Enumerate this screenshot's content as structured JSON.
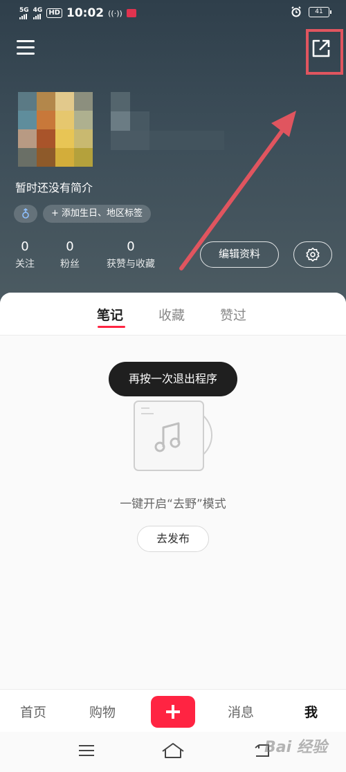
{
  "status_bar": {
    "network_1": "5G",
    "network_2": "4G",
    "hd_badge": "HD",
    "time": "10:02",
    "battery_level": "41"
  },
  "profile": {
    "bio": "暂时还没有简介",
    "gender_icon": "male-symbol",
    "add_tags_label": "+ 添加生日、地区标签",
    "stats": [
      {
        "value": "0",
        "label": "关注"
      },
      {
        "value": "0",
        "label": "粉丝"
      },
      {
        "value": "0",
        "label": "获赞与收藏"
      }
    ],
    "edit_label": "编辑资料"
  },
  "tabs": [
    {
      "label": "笔记",
      "active": true
    },
    {
      "label": "收藏",
      "active": false
    },
    {
      "label": "赞过",
      "active": false
    }
  ],
  "toast": "再按一次退出程序",
  "empty_state": {
    "icon": "music-note-record-icon",
    "text": "一键开启“去野”模式",
    "button_label": "去发布"
  },
  "bottom_nav": {
    "items": [
      {
        "label": "首页",
        "active": false
      },
      {
        "label": "购物",
        "active": false
      },
      {
        "label": "消息",
        "active": false
      },
      {
        "label": "我",
        "active": true
      }
    ]
  },
  "watermark": "Bai 经验",
  "colors": {
    "accent": "#ff2442",
    "highlight_annotation": "#e0555f",
    "header_bg": "#3d4e59"
  }
}
